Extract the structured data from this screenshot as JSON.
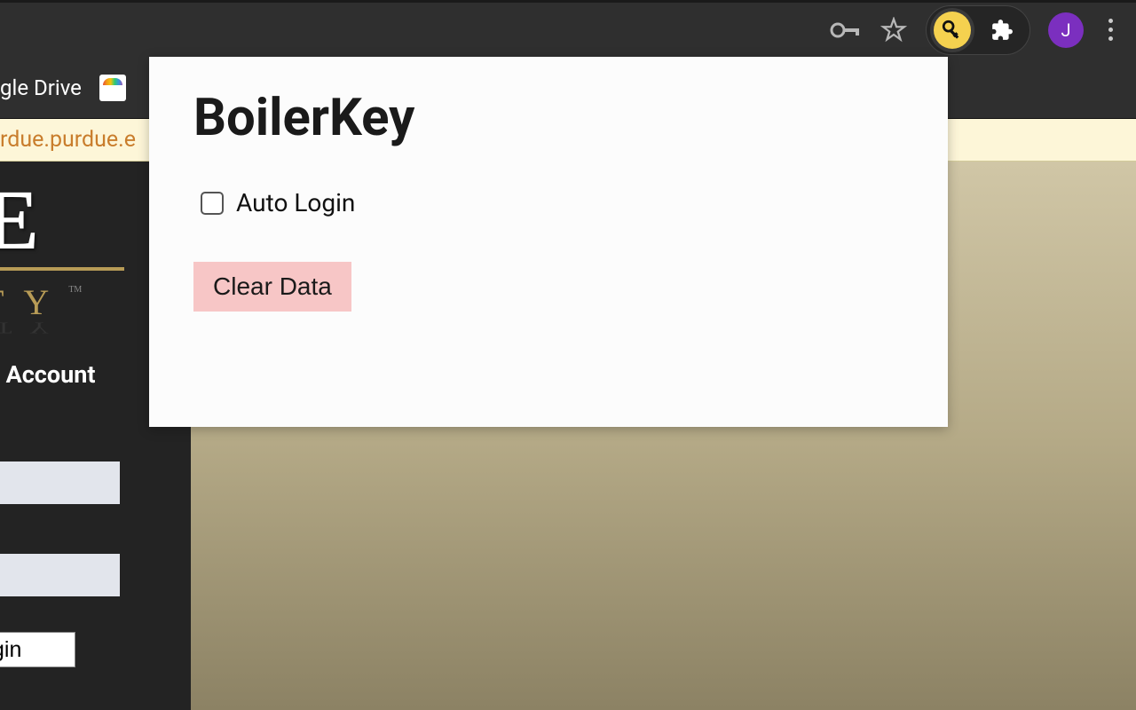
{
  "chrome": {
    "avatar_letter": "J"
  },
  "bookmarks": {
    "item1": "gle Drive"
  },
  "notice": {
    "text": "rdue.purdue.e"
  },
  "login_panel": {
    "school_main": "E",
    "school_sub": "TY",
    "tm": "TM",
    "account_label": "r Account",
    "login_btn": "gin"
  },
  "popup": {
    "title": "BoilerKey",
    "checkbox_label": "Auto Login",
    "clear_btn": "Clear Data"
  }
}
